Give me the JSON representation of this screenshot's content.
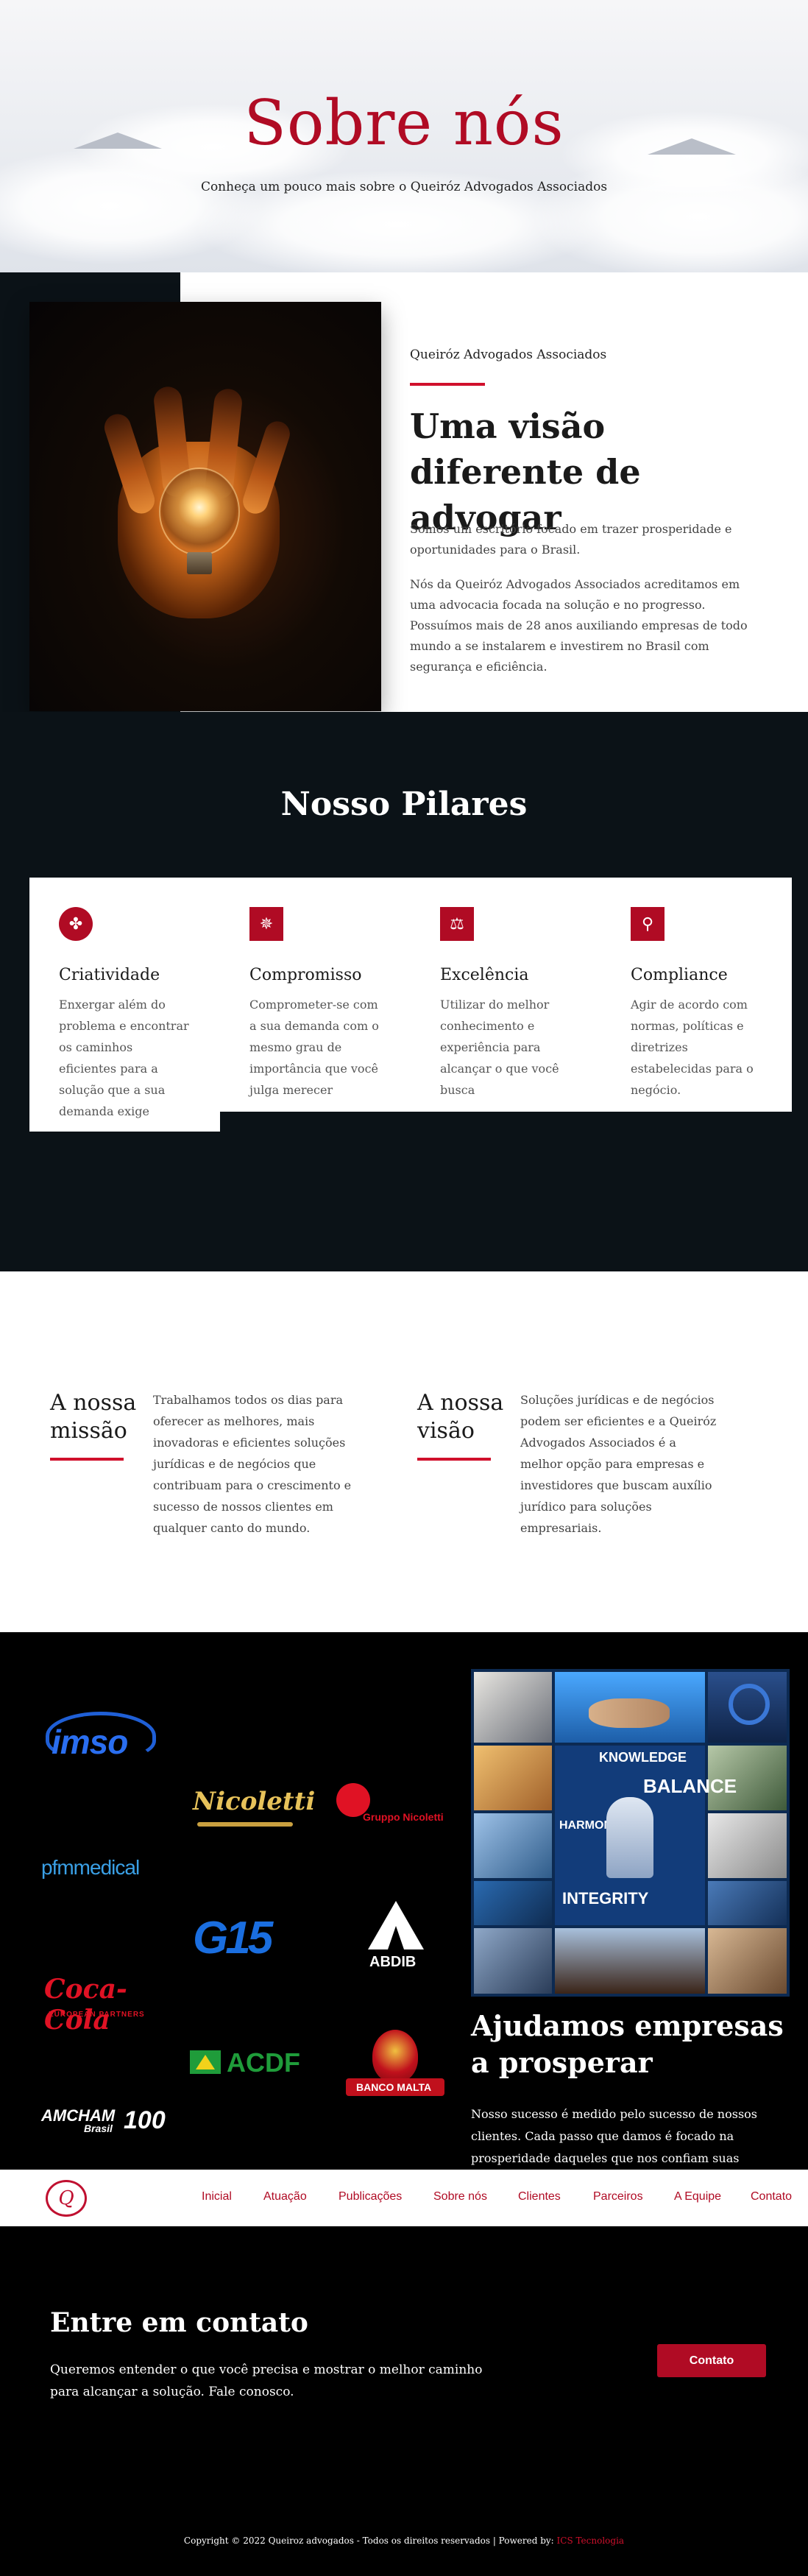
{
  "hero": {
    "title": "Sobre nós",
    "subtitle": "Conheça um pouco mais sobre o Queiróz Advogados Associados"
  },
  "about": {
    "kicker": "Queiróz Advogados Associados",
    "title": "Uma visão diferente de advogar",
    "paragraph_1": "Somos um escritório focado em trazer prosperidade e oportunidades para o Brasil.",
    "paragraph_2": "Nós da Queiróz Advogados Associados acreditamos em uma advocacia focada na solução e no progresso. Possuímos mais de 28 anos auxiliando empresas de todo mundo a se instalarem e investirem no Brasil com segurança e eficiência."
  },
  "pilares": {
    "title": "Nosso Pilares",
    "cards": [
      {
        "icon": "swirl-icon",
        "glyph": "✤",
        "title": "Criatividade",
        "text": "Enxergar além do problema e encontrar os caminhos eficientes para a solução que a sua demanda exige"
      },
      {
        "icon": "gear-icon",
        "glyph": "✵",
        "title": "Compromisso",
        "text": "Comprometer-se com a sua demanda com o mesmo grau de importância que você julga merecer"
      },
      {
        "icon": "scale-icon",
        "glyph": "⚖",
        "title": "Excelência",
        "text": "Utilizar do melhor conhecimento e experiência para alcançar o que você busca"
      },
      {
        "icon": "pin-icon",
        "glyph": "⚲",
        "title": "Compliance",
        "text": "Agir de acordo com normas, políticas e diretrizes estabelecidas para o negócio."
      }
    ]
  },
  "mission": {
    "title": "A nossa missão",
    "text": "Trabalhamos todos os dias para oferecer as melhores, mais inovadoras e eficientes soluções jurídicas e de negócios que contribuam para o crescimento e sucesso de nossos clientes em qualquer canto do mundo."
  },
  "vision": {
    "title": "A nossa visão",
    "text": "Soluções jurídicas e de negócios podem ser eficientes e a Queiróz Advogados Associados é a melhor opção para empresas e investidores que buscam auxílio jurídico para soluções empresariais."
  },
  "clients": {
    "logos": {
      "imso": "imso",
      "nicoletti": "Nicoletti",
      "gruppo": "Gruppo Nicoletti",
      "pfm": "pfmmedical",
      "g15": "G15",
      "abdib": "ABDIB",
      "coca": "Coca-Cola",
      "coca_sub": "EUROPEAN PARTNERS",
      "acdf": "ACDF",
      "malta": "BANCO MALTA",
      "amcham": "AMCHAM",
      "amcham_brasil": "Brasil",
      "amcham_100": "100"
    },
    "collage_words": [
      "KNOWLEDGE",
      "BALANCE",
      "HARMONY",
      "INTEGRITY"
    ],
    "help_title": "Ajudamos empresas a prosperar",
    "help_text": "Nosso sucesso é medido pelo sucesso de nossos clientes. Cada passo que damos é focado na prosperidade daqueles que nos confiam suas"
  },
  "nav": {
    "logo_text": "Q",
    "items": [
      "Inicial",
      "Atuação",
      "Publicações",
      "Sobre nós",
      "Clientes",
      "Parceiros",
      "A Equipe",
      "Contato"
    ]
  },
  "contact": {
    "title": "Entre em contato",
    "text": "Queremos entender o que você precisa e mostrar o melhor caminho para alcançar a solução. Fale conosco.",
    "button": "Contato"
  },
  "footer": {
    "copyright": "Copyright © 2022 Queiroz advogados - Todos os direitos reservados | Powered by: ",
    "brand": "ICS Tecnologia"
  },
  "colors": {
    "accent": "#b00b24",
    "rule": "#d0102c",
    "dark": "#0b1217"
  }
}
